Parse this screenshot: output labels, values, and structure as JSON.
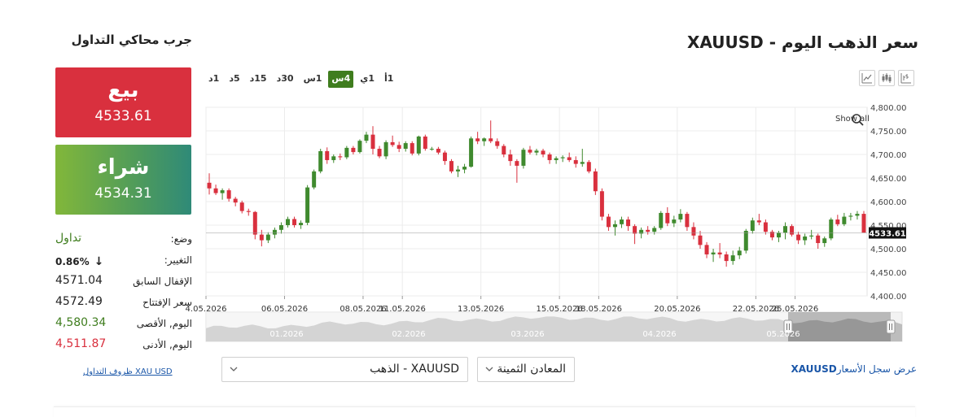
{
  "page": {
    "title": "سعر الذهب اليوم - XAUUSD",
    "simulator_title": "جرب محاكي التداول"
  },
  "toolbar": {
    "icons": [
      "line-chart-icon",
      "candlestick-icon",
      "bar-ohlc-icon"
    ]
  },
  "timeframes": [
    {
      "label": "1أ",
      "active": false
    },
    {
      "label": "1ي",
      "active": false
    },
    {
      "label": "4س",
      "active": true
    },
    {
      "label": "1س",
      "active": false
    },
    {
      "label": "30د",
      "active": false
    },
    {
      "label": "15د",
      "active": false
    },
    {
      "label": "5د",
      "active": false
    },
    {
      "label": "1د",
      "active": false
    }
  ],
  "trade": {
    "sell_label": "بيع",
    "sell_price": "4533.61",
    "buy_label": "شراء",
    "buy_price": "4534.31"
  },
  "stats": {
    "status_label": "وضع:",
    "status_value": "تداول",
    "change_label": "التغيير:",
    "change_value": "0.86%",
    "prev_close_label": "الإقفال السابق",
    "prev_close_value": "4571.04",
    "open_label": "سعر الإفتتاح",
    "open_value": "4572.49",
    "high_label": "اليوم, الأقصى",
    "high_value": "4,580.34",
    "low_label": "اليوم, الأدنى",
    "low_value": "4,511.87"
  },
  "links": {
    "conditions": "XAU USD ظروف التداول",
    "history_symbol": "XAUUSD",
    "history_text": "عرض سجل الأسعار"
  },
  "selects": {
    "category": "المعادن الثمينة",
    "instrument": "XAUUSD - الذهب"
  },
  "colors": {
    "up": "#3f8a2e",
    "down": "#d9303e",
    "sell": "#d9303e",
    "active_timeframe": "#3f7d1e",
    "link": "#1a56a8"
  },
  "chart_data": {
    "type": "candlestick",
    "title": "",
    "show_all_label": "Show all",
    "ylim": [
      4400,
      4800
    ],
    "y_ticks": [
      "4,800.00",
      "4,750.00",
      "4,700.00",
      "4,650.00",
      "4,600.00",
      "4,550.00",
      "4,500.00",
      "4,450.00",
      "4,400.00"
    ],
    "y_tick_values": [
      4800,
      4750,
      4700,
      4650,
      4600,
      4550,
      4500,
      4450,
      4400
    ],
    "x_ticks": [
      "4.05.2026",
      "06.05.2026",
      "08.05.2026",
      "11.05.2026",
      "13.05.2026",
      "15.05.2026",
      "18.05.2026",
      "20.05.2026",
      "22.05.2026",
      "25.05.2026"
    ],
    "x_tick_index": [
      0,
      12,
      24,
      30,
      42,
      54,
      60,
      72,
      84,
      90
    ],
    "current_price": 4533.61,
    "current_price_label": "4533.61",
    "navigator_labels": [
      "01.2026",
      "02.2026",
      "03.2026",
      "04.2026",
      "05.2026"
    ],
    "grid": true,
    "candles": [
      [
        4640,
        4660,
        4615,
        4628
      ],
      [
        4628,
        4636,
        4614,
        4618
      ],
      [
        4618,
        4628,
        4604,
        4624
      ],
      [
        4624,
        4628,
        4600,
        4606
      ],
      [
        4606,
        4610,
        4590,
        4598
      ],
      [
        4598,
        4602,
        4575,
        4580
      ],
      [
        4580,
        4585,
        4570,
        4578
      ],
      [
        4578,
        4580,
        4520,
        4530
      ],
      [
        4530,
        4540,
        4505,
        4518
      ],
      [
        4518,
        4535,
        4512,
        4530
      ],
      [
        4530,
        4545,
        4522,
        4540
      ],
      [
        4540,
        4556,
        4532,
        4550
      ],
      [
        4550,
        4568,
        4545,
        4563
      ],
      [
        4563,
        4568,
        4545,
        4550
      ],
      [
        4550,
        4560,
        4542,
        4555
      ],
      [
        4555,
        4635,
        4550,
        4630
      ],
      [
        4630,
        4668,
        4626,
        4664
      ],
      [
        4664,
        4712,
        4660,
        4707
      ],
      [
        4707,
        4715,
        4680,
        4688
      ],
      [
        4688,
        4700,
        4682,
        4696
      ],
      [
        4696,
        4702,
        4688,
        4694
      ],
      [
        4694,
        4718,
        4690,
        4714
      ],
      [
        4714,
        4718,
        4700,
        4705
      ],
      [
        4705,
        4732,
        4702,
        4729
      ],
      [
        4729,
        4748,
        4724,
        4742
      ],
      [
        4742,
        4760,
        4700,
        4712
      ],
      [
        4712,
        4718,
        4692,
        4696
      ],
      [
        4696,
        4730,
        4690,
        4726
      ],
      [
        4726,
        4740,
        4716,
        4720
      ],
      [
        4720,
        4727,
        4705,
        4712
      ],
      [
        4712,
        4728,
        4706,
        4724
      ],
      [
        4724,
        4728,
        4698,
        4702
      ],
      [
        4702,
        4740,
        4698,
        4738
      ],
      [
        4738,
        4742,
        4708,
        4712
      ],
      [
        4712,
        4716,
        4708,
        4712
      ],
      [
        4712,
        4716,
        4700,
        4704
      ],
      [
        4704,
        4708,
        4678,
        4686
      ],
      [
        4686,
        4690,
        4660,
        4664
      ],
      [
        4664,
        4676,
        4652,
        4668
      ],
      [
        4668,
        4680,
        4660,
        4674
      ],
      [
        4674,
        4738,
        4672,
        4734
      ],
      [
        4734,
        4748,
        4722,
        4728
      ],
      [
        4728,
        4736,
        4718,
        4734
      ],
      [
        4734,
        4772,
        4724,
        4728
      ],
      [
        4728,
        4734,
        4712,
        4718
      ],
      [
        4718,
        4722,
        4694,
        4700
      ],
      [
        4700,
        4710,
        4676,
        4686
      ],
      [
        4686,
        4690,
        4640,
        4676
      ],
      [
        4676,
        4714,
        4670,
        4710
      ],
      [
        4710,
        4718,
        4700,
        4704
      ],
      [
        4704,
        4712,
        4698,
        4708
      ],
      [
        4708,
        4712,
        4694,
        4700
      ],
      [
        4700,
        4704,
        4680,
        4688
      ],
      [
        4688,
        4696,
        4680,
        4692
      ],
      [
        4692,
        4698,
        4684,
        4694
      ],
      [
        4694,
        4704,
        4684,
        4688
      ],
      [
        4688,
        4696,
        4672,
        4680
      ],
      [
        4680,
        4712,
        4674,
        4684
      ],
      [
        4684,
        4688,
        4660,
        4664
      ],
      [
        4664,
        4670,
        4614,
        4622
      ],
      [
        4622,
        4628,
        4560,
        4568
      ],
      [
        4568,
        4574,
        4538,
        4546
      ],
      [
        4546,
        4560,
        4528,
        4552
      ],
      [
        4552,
        4568,
        4544,
        4562
      ],
      [
        4562,
        4568,
        4538,
        4548
      ],
      [
        4548,
        4552,
        4510,
        4532
      ],
      [
        4532,
        4545,
        4522,
        4540
      ],
      [
        4540,
        4548,
        4530,
        4536
      ],
      [
        4536,
        4548,
        4530,
        4544
      ],
      [
        4544,
        4580,
        4540,
        4576
      ],
      [
        4576,
        4588,
        4548,
        4554
      ],
      [
        4554,
        4570,
        4546,
        4562
      ],
      [
        4562,
        4584,
        4556,
        4574
      ],
      [
        4574,
        4578,
        4538,
        4546
      ],
      [
        4546,
        4556,
        4520,
        4528
      ],
      [
        4528,
        4538,
        4500,
        4508
      ],
      [
        4508,
        4514,
        4480,
        4488
      ],
      [
        4488,
        4500,
        4472,
        4492
      ],
      [
        4492,
        4512,
        4480,
        4488
      ],
      [
        4488,
        4494,
        4462,
        4474
      ],
      [
        4474,
        4496,
        4466,
        4486
      ],
      [
        4486,
        4504,
        4478,
        4496
      ],
      [
        4496,
        4542,
        4490,
        4538
      ],
      [
        4538,
        4566,
        4532,
        4560
      ],
      [
        4560,
        4574,
        4550,
        4556
      ],
      [
        4556,
        4562,
        4530,
        4536
      ],
      [
        4536,
        4540,
        4518,
        4524
      ],
      [
        4524,
        4538,
        4514,
        4534
      ],
      [
        4534,
        4556,
        4520,
        4548
      ],
      [
        4548,
        4552,
        4526,
        4530
      ],
      [
        4530,
        4536,
        4510,
        4518
      ],
      [
        4518,
        4532,
        4508,
        4526
      ],
      [
        4526,
        4540,
        4520,
        4528
      ],
      [
        4528,
        4532,
        4500,
        4512
      ],
      [
        4512,
        4526,
        4504,
        4522
      ],
      [
        4522,
        4566,
        4518,
        4562
      ],
      [
        4562,
        4572,
        4548,
        4552
      ],
      [
        4552,
        4576,
        4548,
        4568
      ],
      [
        4568,
        4576,
        4560,
        4570
      ],
      [
        4570,
        4580,
        4562,
        4574
      ],
      [
        4574,
        4580,
        4540,
        4534
      ]
    ]
  }
}
